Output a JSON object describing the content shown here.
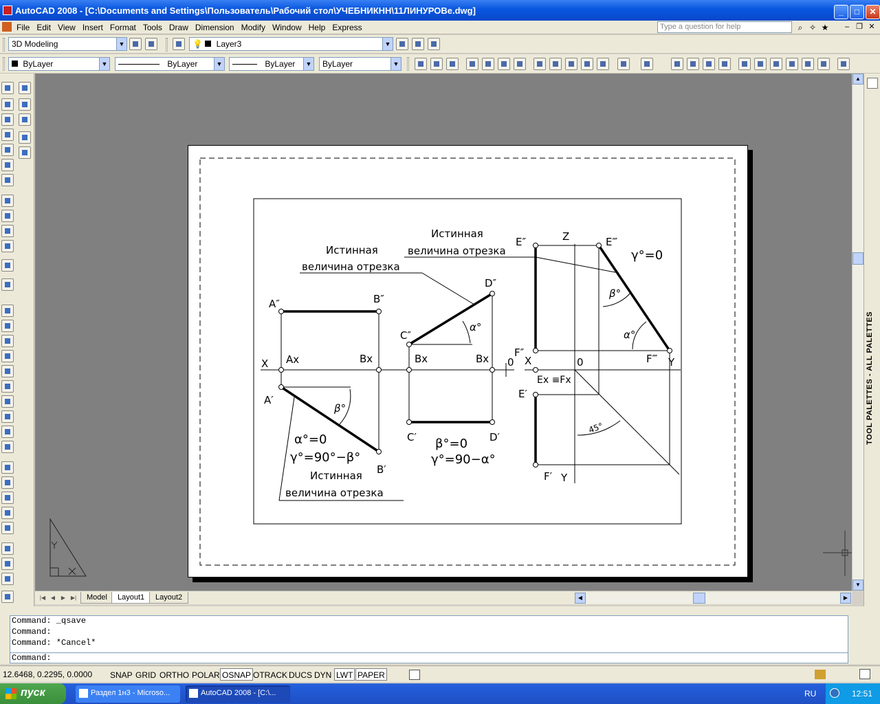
{
  "window": {
    "title": "AutoCAD 2008 - [C:\\Documents and Settings\\Пользователь\\Рабочий стол\\УЧЕБНИКНН\\11ЛИНУРОВе.dwg]",
    "minimize": "_",
    "maximize": "□",
    "close": "✕"
  },
  "menu": [
    "File",
    "Edit",
    "View",
    "Insert",
    "Format",
    "Tools",
    "Draw",
    "Dimension",
    "Modify",
    "Window",
    "Help",
    "Express"
  ],
  "help": {
    "placeholder": "Type a question for help"
  },
  "toolbar": {
    "workspace": "3D Modeling",
    "layer": "Layer3",
    "color": "ByLayer",
    "linetype": "ByLayer",
    "lineweight": "ByLayer",
    "plotstyle": "ByLayer"
  },
  "drawing": {
    "labels": {
      "true_length": "Истинная",
      "segment": "величина отрезка",
      "A2": "A″",
      "B2": "B″",
      "C2": "C″",
      "D2": "D″",
      "E2": "E″",
      "E3": "E‴",
      "F2": "F″",
      "F3": "F‴",
      "A1": "A′",
      "B1": "B′",
      "C1": "C′",
      "D1": "D′",
      "E1": "E′",
      "F1": "F′",
      "X": "X",
      "Y": "Y",
      "Z": "Z",
      "zero": "0",
      "Ax": "Ax",
      "Bx": "Bx",
      "ExFx": "Ex ≡Fx",
      "alpha": "α°",
      "beta": "β°",
      "angle45": "45°",
      "eq1a": "α°=0",
      "eq1b": "γ°=90°−β°",
      "eq2a": "β°=0",
      "eq2b": "γ°=90−α°",
      "eq3": "γ°=0"
    }
  },
  "tabs": [
    "Model",
    "Layout1",
    "Layout2"
  ],
  "command": {
    "history": [
      "Command: _qsave",
      "Command:",
      "Command: *Cancel*"
    ],
    "prompt": "Command:"
  },
  "status": {
    "coords": "12.6468, 0.2295, 0.0000",
    "buttons": [
      "SNAP",
      "GRID",
      "ORTHO",
      "POLAR",
      "OSNAP",
      "OTRACK",
      "DUCS",
      "DYN",
      "LWT",
      "PAPER"
    ]
  },
  "palettes": {
    "label": "TOOL PALETTES - ALL PALETTES"
  },
  "taskbar": {
    "start": "пуск",
    "tasks": [
      "Раздел 1н3 - Microso...",
      "AutoCAD 2008 - [C:\\..."
    ],
    "lang": "RU",
    "time": "12:51"
  }
}
